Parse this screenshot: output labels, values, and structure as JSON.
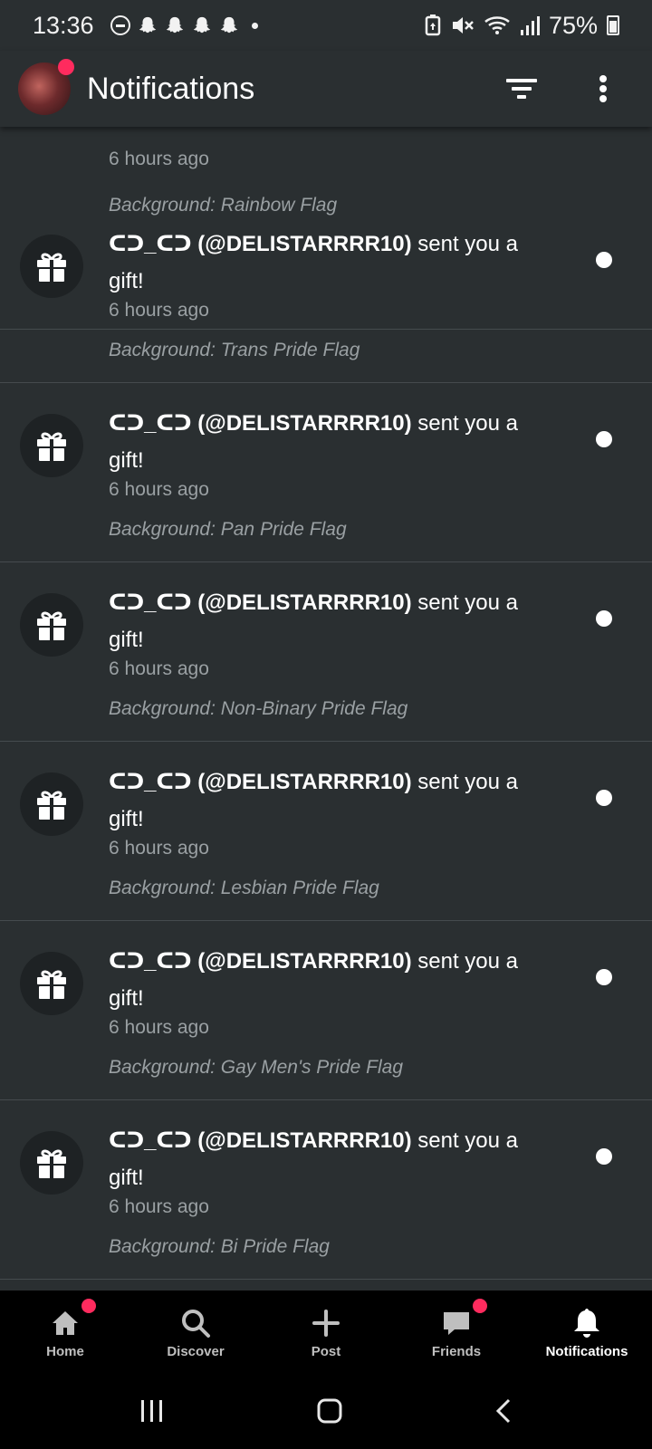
{
  "status_bar": {
    "time": "13:36",
    "battery": "75%"
  },
  "header": {
    "title": "Notifications"
  },
  "partial_item": {
    "time": "6 hours ago",
    "background": "Background: Rainbow Flag"
  },
  "notifications": [
    {
      "user": "ᑕᑐ_ᑕᑐ (@DELISTARRRR10)",
      "action": " sent you a gift!",
      "time": "6 hours ago",
      "background": "Background: Trans Pride Flag"
    },
    {
      "user": "ᑕᑐ_ᑕᑐ (@DELISTARRRR10)",
      "action": " sent you a gift!",
      "time": "6 hours ago",
      "background": "Background: Pan Pride Flag"
    },
    {
      "user": "ᑕᑐ_ᑕᑐ (@DELISTARRRR10)",
      "action": " sent you a gift!",
      "time": "6 hours ago",
      "background": "Background: Non-Binary Pride Flag"
    },
    {
      "user": "ᑕᑐ_ᑕᑐ (@DELISTARRRR10)",
      "action": " sent you a gift!",
      "time": "6 hours ago",
      "background": "Background: Lesbian Pride Flag"
    },
    {
      "user": "ᑕᑐ_ᑕᑐ (@DELISTARRRR10)",
      "action": " sent you a gift!",
      "time": "6 hours ago",
      "background": "Background: Gay Men's Pride Flag"
    },
    {
      "user": "ᑕᑐ_ᑕᑐ (@DELISTARRRR10)",
      "action": " sent you a gift!",
      "time": "6 hours ago",
      "background": "Background: Bi Pride Flag"
    }
  ],
  "bottom_nav": {
    "home": "Home",
    "discover": "Discover",
    "post": "Post",
    "friends": "Friends",
    "notifications": "Notifications"
  },
  "colors": {
    "background": "#2a2f31",
    "badge": "#ff2b5e",
    "muted_text": "#9aa0a3",
    "nav_background": "#000000"
  },
  "icons": {
    "status": [
      "do-not-disturb-icon",
      "snapchat-icon",
      "snapchat-icon",
      "snapchat-icon",
      "snapchat-icon",
      "notification-dot-icon"
    ],
    "status_right": [
      "battery-saver-icon",
      "mute-icon",
      "wifi-icon",
      "signal-icon",
      "battery-icon"
    ],
    "header": [
      "filter-icon",
      "more-vertical-icon"
    ],
    "item": "gift-icon",
    "nav": [
      "home-icon",
      "search-icon",
      "plus-icon",
      "chat-icon",
      "bell-icon"
    ],
    "system": [
      "recent-apps-icon",
      "home-button-icon",
      "back-icon"
    ]
  }
}
